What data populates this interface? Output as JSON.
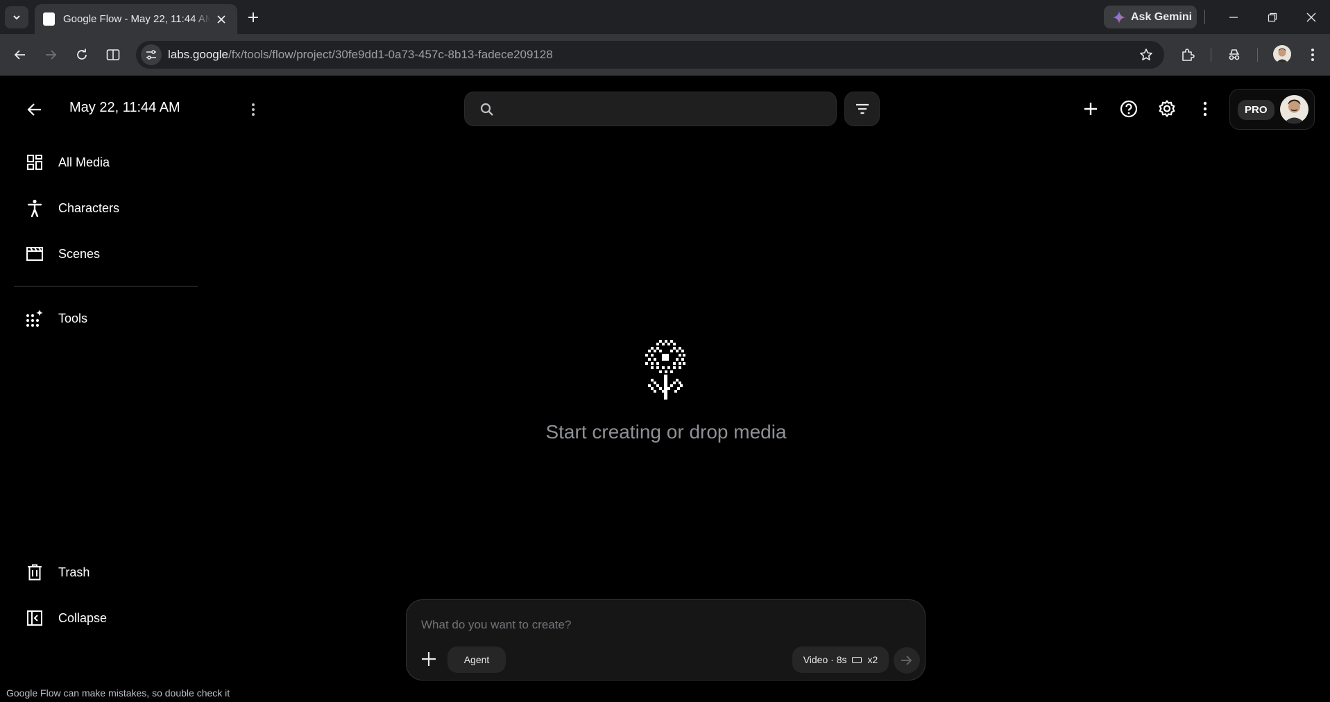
{
  "browser": {
    "tab_title": "Google Flow - May 22, 11:44 AM",
    "ask_gemini": "Ask Gemini",
    "url_host": "labs.google",
    "url_path": "/fx/tools/flow/project/30fe9dd1-0a73-457c-8b13-fadece209128"
  },
  "header": {
    "project_title": "May 22, 11:44 AM",
    "search_placeholder": "",
    "pro_badge": "PRO"
  },
  "sidebar": {
    "items": [
      {
        "label": "All Media",
        "icon": "grid-icon"
      },
      {
        "label": "Characters",
        "icon": "person-icon"
      },
      {
        "label": "Scenes",
        "icon": "clapperboard-icon"
      },
      {
        "label": "Tools",
        "icon": "sparkle-grid-icon"
      }
    ],
    "bottom_items": [
      {
        "label": "Trash",
        "icon": "trash-icon"
      },
      {
        "label": "Collapse",
        "icon": "collapse-icon"
      }
    ]
  },
  "main": {
    "empty_message": "Start creating or drop media"
  },
  "prompt": {
    "placeholder": "What do you want to create?",
    "agent_label": "Agent",
    "mode_label": "Video · 8s",
    "count_label": "x2"
  },
  "footer": {
    "disclaimer": "Google Flow can make mistakes, so double check it"
  },
  "colors": {
    "background": "#000000",
    "chrome_tabstrip": "#202124",
    "chrome_toolbar": "#35363a",
    "muted_text": "#8e9196"
  }
}
